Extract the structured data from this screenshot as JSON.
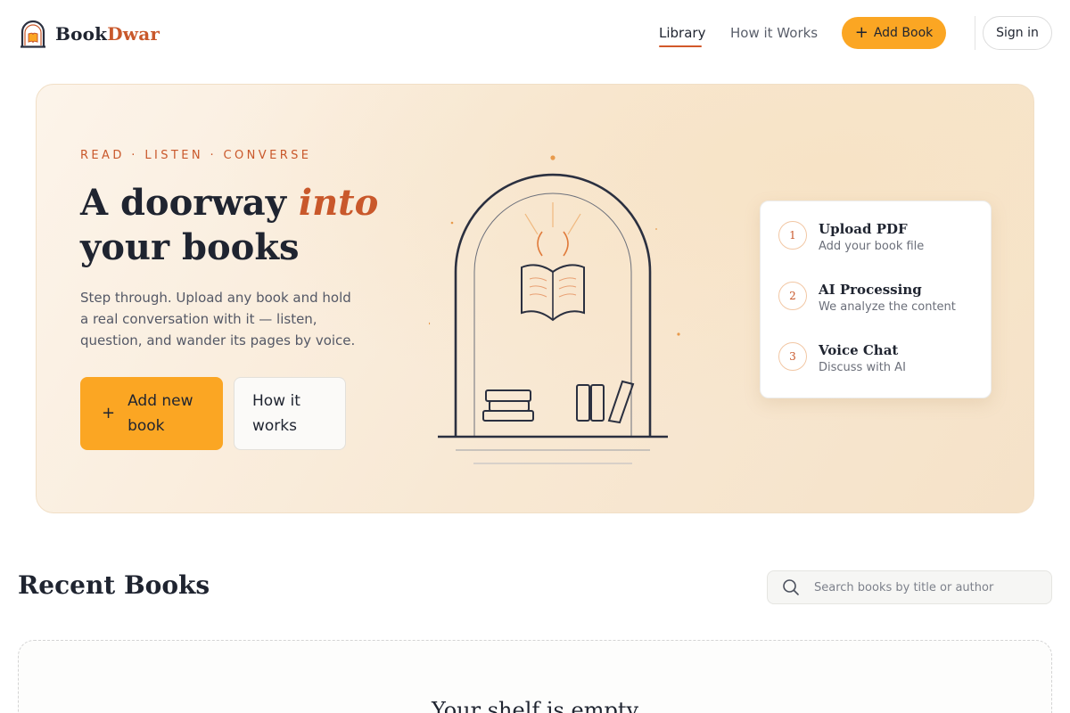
{
  "app": {
    "brand_part1": "Book",
    "brand_part2": "Dwar",
    "accent_color": "#c9582b",
    "cta_color": "#fba623"
  },
  "nav": {
    "items": [
      {
        "label": "Library",
        "active": true
      },
      {
        "label": "How it Works",
        "active": false
      }
    ],
    "add_book_label": "Add Book",
    "sign_in_label": "Sign in"
  },
  "hero": {
    "eyebrow": "READ · LISTEN · CONVERSE",
    "headline_part1": "A doorway ",
    "headline_accent": "into",
    "headline_part2": "your books",
    "description": "Step through. Upload any book and hold a real conversation with it — listen, question, and wander its pages by voice.",
    "primary_cta": "Add new book",
    "secondary_cta": "How it works"
  },
  "steps": [
    {
      "number": "1",
      "title": "Upload PDF",
      "subtitle": "Add your book file"
    },
    {
      "number": "2",
      "title": "AI Processing",
      "subtitle": "We analyze the content"
    },
    {
      "number": "3",
      "title": "Voice Chat",
      "subtitle": "Discuss with AI"
    }
  ],
  "recent": {
    "title": "Recent Books",
    "search_placeholder": "Search books by title or author",
    "empty_title": "Your shelf is empty"
  },
  "icons": {
    "logo": "doorway-book-icon",
    "search": "search-icon",
    "plus": "plus-icon"
  }
}
